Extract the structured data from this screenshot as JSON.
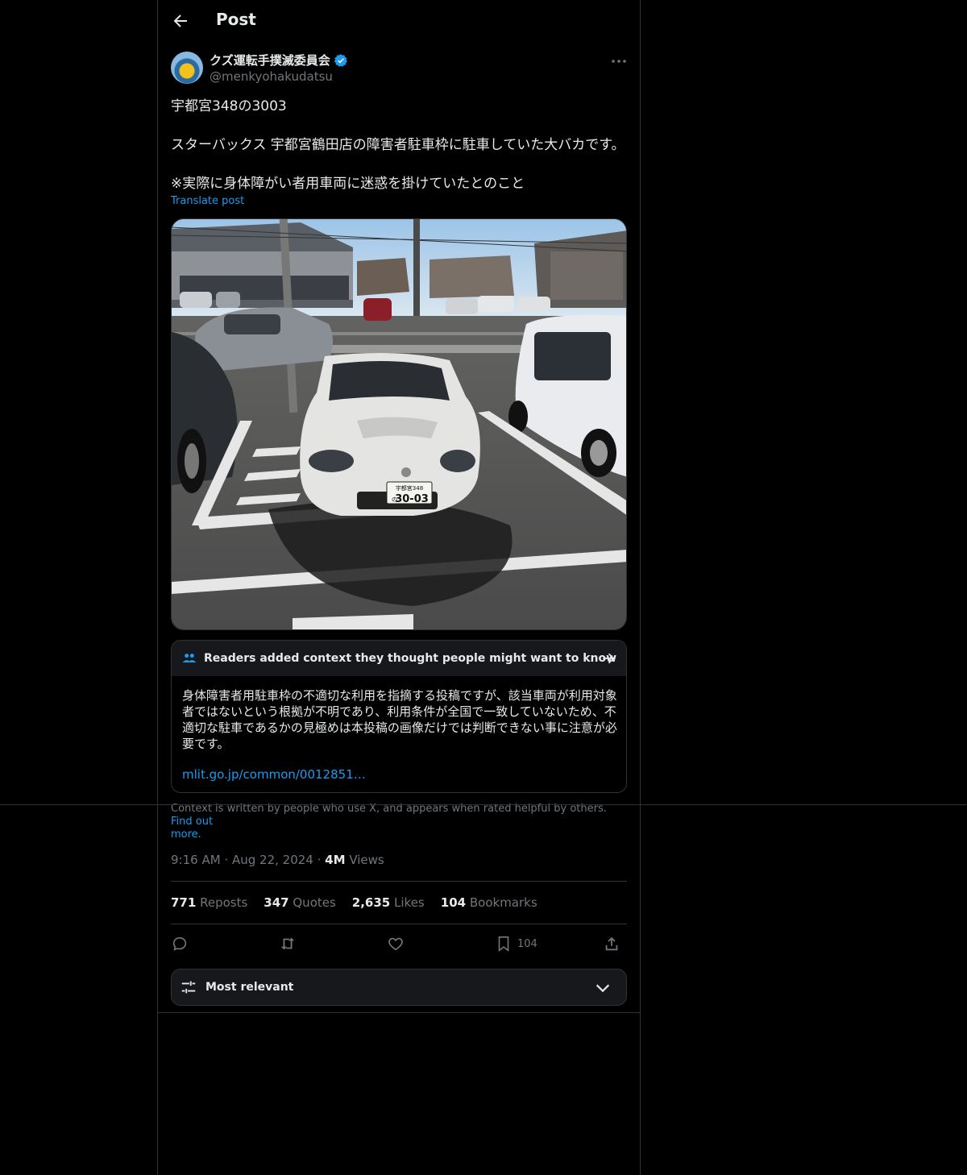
{
  "header": {
    "title": "Post"
  },
  "author": {
    "name": "クズ運転手撲滅委員会",
    "handle": "@menkyohakudatsu",
    "verified": true
  },
  "post": {
    "lines": [
      "宇都宮348の3003",
      "",
      "スターバックス 宇都宮鶴田店の障害者駐車枠に駐車していた大バカです。",
      "",
      "※実際に身体障がい者用車両に迷惑を掛けていたとのこと"
    ],
    "translate_label": "Translate post",
    "plate": {
      "top": "宇都宮348",
      "kana": "の",
      "number": "30-03"
    }
  },
  "community_note": {
    "header": "Readers added context they thought people might want to know",
    "body_lines": [
      "身体障害者用駐車枠の不適切な利用を指摘する投稿ですが、該当車両が利用対象",
      "者ではないという根拠が不明であり、利用条件が全国で一致していないため、不",
      "適切な駐車であるかの見極めは本投稿の画像だけでは判断できない事に注意が必",
      "要です。"
    ],
    "link": "mlit.go.jp/common/0012851…",
    "footer": "Context is written by people who use X, and appears when rated helpful by others.",
    "find_out": "Find out",
    "find_out_2": "more."
  },
  "meta": {
    "time": "9:16 AM",
    "date": "Aug 22, 2024",
    "views_count": "4M",
    "views_label": "Views"
  },
  "stats": [
    {
      "count": "771",
      "label": "Reposts"
    },
    {
      "count": "347",
      "label": "Quotes"
    },
    {
      "count": "2,635",
      "label": "Likes"
    },
    {
      "count": "104",
      "label": "Bookmarks"
    }
  ],
  "actions": {
    "bookmark_count": "104"
  },
  "sort": {
    "label": "Most relevant"
  },
  "icons": [
    "back-arrow-icon",
    "verified-badge-icon",
    "more-icon",
    "people-icon",
    "arrow-right-icon",
    "reply-icon",
    "repost-icon",
    "like-icon",
    "bookmark-icon",
    "share-icon",
    "sliders-icon",
    "chevron-down-icon"
  ],
  "colors": {
    "accent": "#1d9bf0",
    "muted": "#71767b",
    "border": "#2f3336",
    "background": "#000000"
  }
}
